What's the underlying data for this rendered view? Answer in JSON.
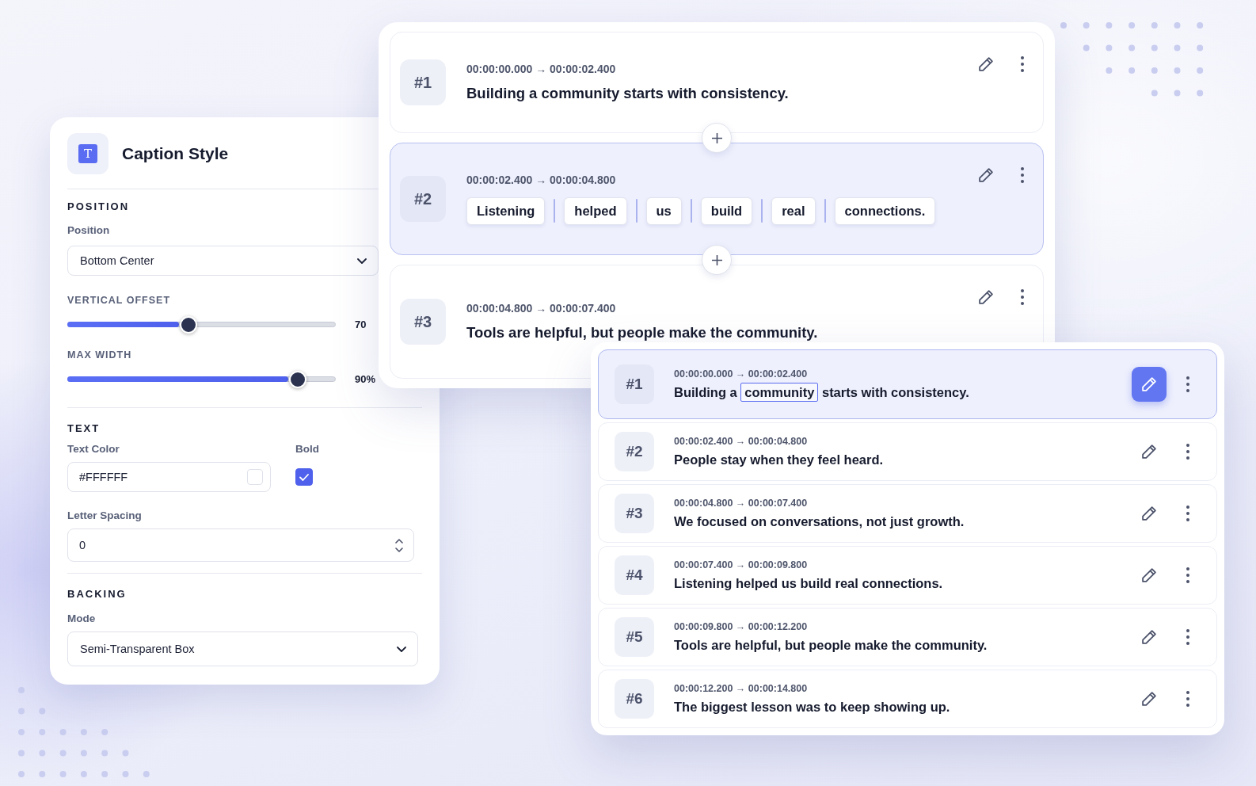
{
  "caption_style_panel": {
    "icon_glyph": "T",
    "title": "Caption Style",
    "position_section": {
      "heading": "POSITION",
      "position_field": {
        "label": "Position",
        "value": "Bottom Center"
      },
      "sliders": [
        {
          "label": "VERTICAL OFFSET",
          "level": 0.45,
          "reading": "70"
        },
        {
          "label": "MAX WIDTH",
          "level": 0.86,
          "reading": "90%"
        }
      ]
    },
    "text_section": {
      "heading": "TEXT",
      "text_color": {
        "label": "Text Color",
        "value": "#FFFFFF"
      },
      "bold": {
        "label": "Bold",
        "checked": true
      },
      "letter_spacing": {
        "label": "Letter Spacing",
        "value": "0"
      }
    },
    "backing_section": {
      "heading": "BACKING",
      "mode": {
        "label": "Mode",
        "value": "Semi-Transparent Box"
      }
    }
  },
  "timeline_card": {
    "segments": [
      {
        "number": "#1",
        "timecode": "00:00:00.000 → 00:00:02.400",
        "selected": false,
        "kind": "sentence",
        "text": "Building a community starts with consistency."
      },
      {
        "number": "#2",
        "timecode": "00:00:02.400 → 00:00:04.800",
        "selected": true,
        "kind": "word_chips",
        "words": [
          "Listening",
          "helped",
          "us",
          "build",
          "real",
          "connections."
        ]
      },
      {
        "number": "#3",
        "timecode": "00:00:04.800 → 00:00:07.400",
        "selected": false,
        "kind": "sentence",
        "text": "Tools are helpful, but people make the community."
      }
    ]
  },
  "segment_list": {
    "segments": [
      {
        "number": "#1",
        "timecode": "00:00:00.000 → 00:00:02.400",
        "selected": true,
        "editing": true,
        "parts": [
          {
            "text": "Building a",
            "focused": false
          },
          {
            "text": "community",
            "focused": true
          },
          {
            "text": "starts with consistency.",
            "focused": false
          }
        ]
      },
      {
        "number": "#2",
        "timecode": "00:00:02.400 → 00:00:04.800",
        "selected": false,
        "editing": false,
        "parts": [
          {
            "text": "People stay when they feel heard.",
            "focused": false
          }
        ]
      },
      {
        "number": "#3",
        "timecode": "00:00:04.800 → 00:00:07.400",
        "selected": false,
        "editing": false,
        "parts": [
          {
            "text": "We focused on conversations, not just growth.",
            "focused": false
          }
        ]
      },
      {
        "number": "#4",
        "timecode": "00:00:07.400 → 00:00:09.800",
        "selected": false,
        "editing": false,
        "parts": [
          {
            "text": "Listening helped us build real connections.",
            "focused": false
          }
        ]
      },
      {
        "number": "#5",
        "timecode": "00:00:09.800 → 00:00:12.200",
        "selected": false,
        "editing": false,
        "parts": [
          {
            "text": "Tools are helpful, but people make the community.",
            "focused": false
          }
        ]
      },
      {
        "number": "#6",
        "timecode": "00:00:12.200 → 00:00:14.800",
        "selected": false,
        "editing": false,
        "parts": [
          {
            "text": "The biggest lesson was to keep showing up.",
            "focused": false
          }
        ]
      }
    ]
  }
}
